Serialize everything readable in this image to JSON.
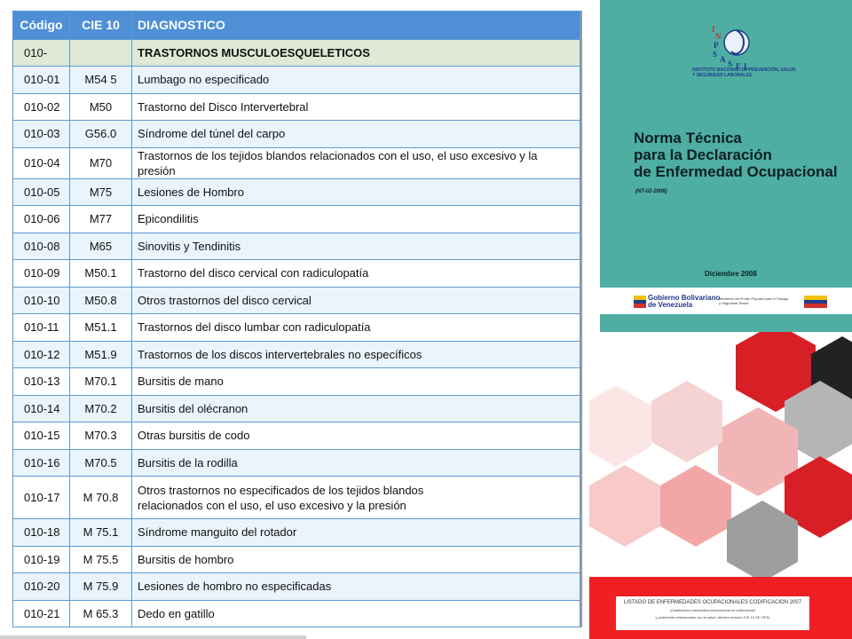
{
  "table": {
    "headers": {
      "code": "Código",
      "cie": "CIE 10",
      "diag": "DIAGNOSTICO"
    },
    "section": {
      "code": "010-",
      "cie": "",
      "diag": "TRASTORNOS MUSCULOESQUELETICOS"
    },
    "rows": [
      {
        "code": "010-01",
        "cie": "M54 5",
        "diag": "Lumbago no especificado"
      },
      {
        "code": "010-02",
        "cie": "M50",
        "diag": "Trastorno del Disco Intervertebral"
      },
      {
        "code": "010-03",
        "cie": "G56.0",
        "diag": "Síndrome del túnel del carpo"
      },
      {
        "code": "010-04",
        "cie": "M70",
        "diag": "Trastornos de los tejidos blandos relacionados con el uso, el uso excesivo y la presión"
      },
      {
        "code": "010-05",
        "cie": "M75",
        "diag": "Lesiones de Hombro"
      },
      {
        "code": "010-06",
        "cie": "M77",
        "diag": "Epicondilitis"
      },
      {
        "code": "010-08",
        "cie": "M65",
        "diag": "Sinovitis y Tendinitis"
      },
      {
        "code": "010-09",
        "cie": "M50.1",
        "diag": "Trastorno del disco cervical con radiculopatía"
      },
      {
        "code": "010-10",
        "cie": "M50.8",
        "diag": "Otros trastornos del disco cervical"
      },
      {
        "code": "010-11",
        "cie": "M51.1",
        "diag": "Trastornos del disco lumbar con radiculopatía"
      },
      {
        "code": "010-12",
        "cie": "M51.9",
        "diag": "Trastornos de los discos intervertebrales no específicos"
      },
      {
        "code": "010-13",
        "cie": "M70.1",
        "diag": "Bursitis de mano"
      },
      {
        "code": "010-14",
        "cie": "M70.2",
        "diag": "Bursitis del olécranon"
      },
      {
        "code": "010-15",
        "cie": "M70.3",
        "diag": "Otras bursitis de codo"
      },
      {
        "code": "010-16",
        "cie": "M70.5",
        "diag": "Bursitis de la rodilla"
      },
      {
        "code": "010-17",
        "cie": "M 70.8",
        "diag": "Otros trastornos no especificados de los tejidos blandos",
        "diag2": "relacionados con el uso, el uso excesivo y la presión"
      },
      {
        "code": "010-18",
        "cie": "M 75.1",
        "diag": "Síndrome manguito del rotador"
      },
      {
        "code": "010-19",
        "cie": "M 75.5",
        "diag": "Bursitis de hombro"
      },
      {
        "code": "010-20",
        "cie": "M 75.9",
        "diag": "Lesiones de hombro no especificadas"
      },
      {
        "code": "010-21",
        "cie": "M 65.3",
        "diag": "Dedo en gatillo"
      }
    ]
  },
  "cover_top": {
    "logo_letters": "INPSASEL",
    "institute": "INSTITUTO NACIONAL DE PREVENCIÓN, SALUD Y SEGURIDAD LABORALES",
    "title_line1": "Norma Técnica",
    "title_line2": "para la Declaración",
    "title_line3": "de Enfermedad Ocupacional",
    "code": "(NT-02-2008)",
    "date": "Diciembre 2008",
    "gob_line1": "Gobierno Bolivariano",
    "gob_line2": "de Venezuela",
    "ministry": "Ministerio del Poder Popular para el Trabajo y Seguridad Social"
  },
  "cover_bottom": {
    "list_title": "LISTADO DE ENFERMEDADES OCUPACIONALES CODIFICACION 2007",
    "sub1": "(Clasificación estadística internacional de enfermedad",
    "sub2": "y problemas relacionados con la salud, décima revisión CIE-10 DE OPS)"
  },
  "colors": {
    "header_blue": "#4f8fd6",
    "row_light": "#eaf4fc",
    "section_green": "#dfe9d6",
    "cover_teal": "#4eaea2",
    "cover_red": "#ef1f23"
  }
}
